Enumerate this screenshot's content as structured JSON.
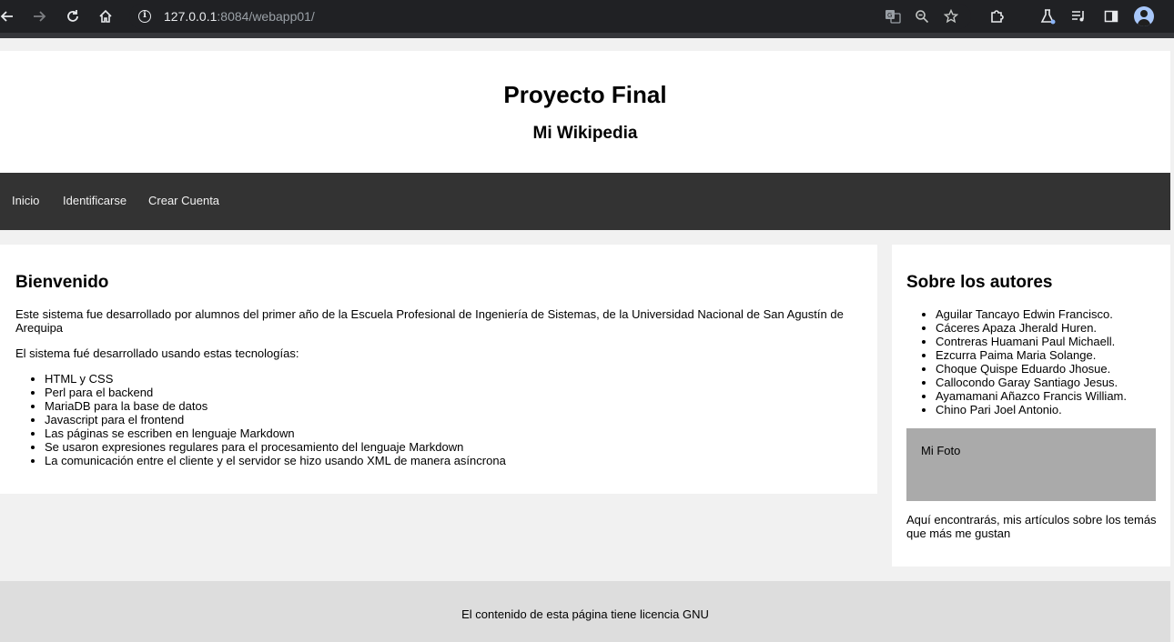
{
  "browser": {
    "url_host": "127.0.0.1",
    "url_rest": ":8084/webapp01/"
  },
  "header": {
    "title": "Proyecto Final",
    "subtitle": "Mi Wikipedia"
  },
  "nav": {
    "items": [
      "Inicio",
      "Identificarse",
      "Crear Cuenta"
    ]
  },
  "main": {
    "title": "Bienvenido",
    "intro": "Este sistema fue desarrollado por alumnos del primer año de la Escuela Profesional de Ingeniería de Sistemas, de la Universidad Nacional de San Agustín de Arequipa",
    "tech_intro": "El sistema fué desarrollado usando estas tecnologías:",
    "technologies": [
      "HTML y CSS",
      "Perl para el backend",
      "MariaDB para la base de datos",
      "Javascript para el frontend",
      "Las páginas se escriben en lenguaje Markdown",
      "Se usaron expresiones regulares para el procesamiento del lenguaje Markdown",
      "La comunicación entre el cliente y el servidor se hizo usando XML de manera asíncrona"
    ]
  },
  "sidebar": {
    "title": "Sobre los autores",
    "authors": [
      "Aguilar Tancayo Edwin Francisco.",
      "Cáceres Apaza Jherald Huren.",
      "Contreras Huamani Paul Michaell.",
      "Ezcurra Paima Maria Solange.",
      "Choque Quispe Eduardo Jhosue.",
      "Callocondo Garay Santiago Jesus.",
      "Ayamamani Añazco Francis William.",
      "Chino Pari Joel Antonio."
    ],
    "photo_label": "Mi Foto",
    "note": "Aquí encontrarás, mis artículos sobre los temás que más me gustan"
  },
  "footer": {
    "text": "El contenido de esta página tiene licencia GNU"
  },
  "colors": {
    "nav_bg": "#333333",
    "page_bg": "#f1f1f1",
    "footer_bg": "#dddddd",
    "photo_bg": "#aaaaaa"
  },
  "icons": {
    "back": "back-arrow-icon",
    "forward": "forward-arrow-icon",
    "reload": "reload-icon",
    "home": "home-icon",
    "site_info": "info-icon",
    "translate": "translate-icon",
    "zoom": "zoom-icon",
    "bookmark": "star-icon",
    "extensions": "puzzle-icon",
    "labs": "flask-icon",
    "media": "media-queue-icon",
    "side_panel": "side-panel-icon",
    "profile": "profile-avatar-icon"
  }
}
